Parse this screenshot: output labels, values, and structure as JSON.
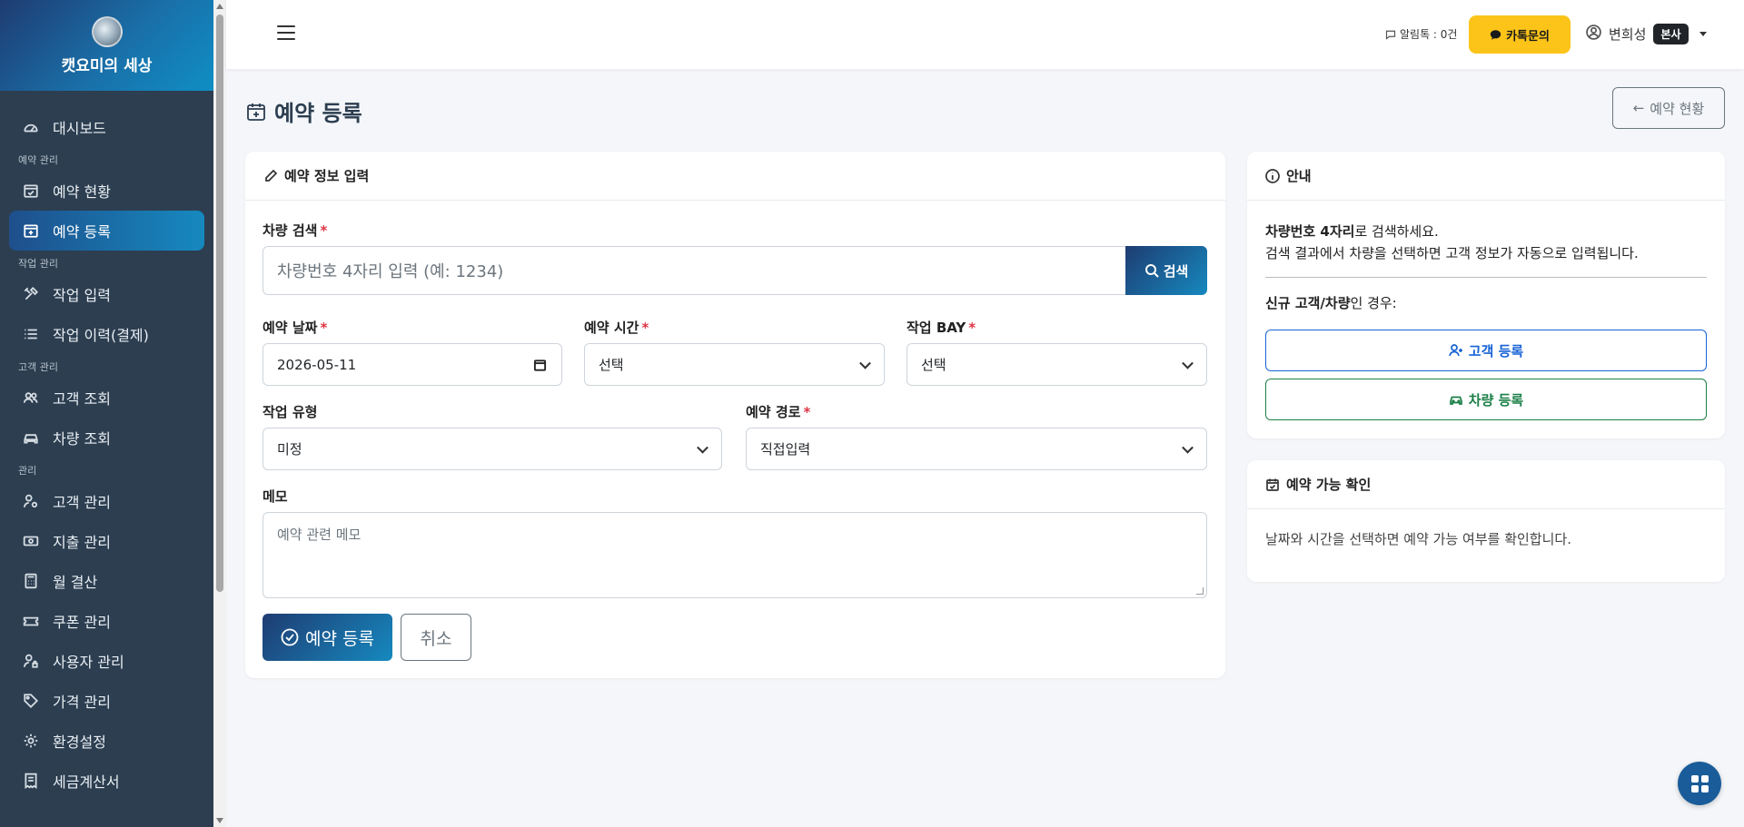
{
  "brand": {
    "name": "캣요미의 세상"
  },
  "sidebar": {
    "sections": [
      {
        "title": "",
        "items": [
          {
            "label": "대시보드",
            "icon": "dashboard-icon",
            "active": false
          }
        ]
      },
      {
        "title": "예약 관리",
        "items": [
          {
            "label": "예약 현황",
            "icon": "calendar-check-icon",
            "active": false
          },
          {
            "label": "예약 등록",
            "icon": "calendar-plus-icon",
            "active": true
          }
        ]
      },
      {
        "title": "작업 관리",
        "items": [
          {
            "label": "작업 입력",
            "icon": "tools-icon",
            "active": false
          },
          {
            "label": "작업 이력(결제)",
            "icon": "list-icon",
            "active": false
          }
        ]
      },
      {
        "title": "고객 관리",
        "items": [
          {
            "label": "고객 조회",
            "icon": "people-icon",
            "active": false
          },
          {
            "label": "차량 조회",
            "icon": "car-icon",
            "active": false
          }
        ]
      },
      {
        "title": "관리",
        "items": [
          {
            "label": "고객 관리",
            "icon": "person-gear-icon",
            "active": false
          },
          {
            "label": "지출 관리",
            "icon": "cash-icon",
            "active": false
          },
          {
            "label": "월 결산",
            "icon": "calculator-icon",
            "active": false
          },
          {
            "label": "쿠폰 관리",
            "icon": "ticket-icon",
            "active": false
          },
          {
            "label": "사용자 관리",
            "icon": "person-lock-icon",
            "active": false
          },
          {
            "label": "가격 관리",
            "icon": "tag-icon",
            "active": false
          },
          {
            "label": "환경설정",
            "icon": "gear-icon",
            "active": false
          },
          {
            "label": "세금계산서",
            "icon": "receipt-icon",
            "active": false
          }
        ]
      }
    ]
  },
  "topbar": {
    "alarm_label": "알림톡 : 0건",
    "kakao_label": "카톡문의",
    "user_name": "변희성",
    "user_badge": "본사"
  },
  "page": {
    "title": "예약 등록",
    "back_label": "예약 현황"
  },
  "form": {
    "header": "예약 정보 입력",
    "vehicle_search": {
      "label": "차량 검색",
      "placeholder": "차량번호 4자리 입력 (예: 1234)",
      "button": "검색"
    },
    "date": {
      "label": "예약 날짜",
      "value": "2026-05-11"
    },
    "time": {
      "label": "예약 시간",
      "value": "선택"
    },
    "bay": {
      "label": "작업 BAY",
      "value": "선택"
    },
    "work_type": {
      "label": "작업 유형",
      "value": "미정"
    },
    "route": {
      "label": "예약 경로",
      "value": "직접입력"
    },
    "memo": {
      "label": "메모",
      "placeholder": "예약 관련 메모"
    },
    "required_mark": "*",
    "submit_label": "예약 등록",
    "cancel_label": "취소"
  },
  "info": {
    "header": "안내",
    "line1_bold": "차량번호 4자리",
    "line1_rest": "로 검색하세요.",
    "line2": "검색 결과에서 차량을 선택하면 고객 정보가 자동으로 입력됩니다.",
    "new_bold": "신규 고객/차량",
    "new_rest": "인 경우:",
    "customer_button": "고객 등록",
    "vehicle_button": "차량 등록"
  },
  "availability": {
    "header": "예약 가능 확인",
    "text": "날짜와 시간을 선택하면 예약 가능 여부를 확인합니다."
  },
  "colors": {
    "sidebar_bg": "#2c3e50",
    "accent_start": "#1e3c72",
    "accent_end": "#1689bf",
    "kakao": "#fcc419",
    "required": "#dc3545"
  }
}
